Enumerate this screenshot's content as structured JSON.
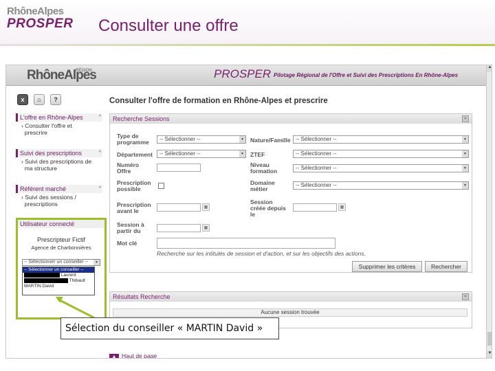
{
  "slide": {
    "logo_top": "RhôneAlpes",
    "logo_main": "PROSPER",
    "title": "Consulter une offre"
  },
  "app": {
    "banner_logo": "RhôneAlpes",
    "banner_logo_sup": "RÉGION",
    "banner_prosper": "PROSPER",
    "banner_subtitle": "Pilotage Régional de l'Offre et Suivi des Prescriptions En Rhône-Alpes",
    "toolbar": {
      "close": "x",
      "home": "⌂",
      "help": "?"
    }
  },
  "sidebar": {
    "sections": [
      {
        "title": "L'offre en Rhône-Alpes",
        "links": [
          "Consulter l'offre et",
          "prescrire"
        ]
      },
      {
        "title": "Suivi des prescriptions",
        "links": [
          "Suivi des prescriptions de",
          "ma structure"
        ]
      },
      {
        "title": "Référent marché",
        "links": [
          "Suivi des sessions /",
          "prescriptions"
        ]
      }
    ],
    "user": {
      "heading": "Utilisateur connecté",
      "name": "Prescripteur Fictif",
      "agency": "Agence de Charbonnières",
      "select_value": "-- Sélectionner un conseiller --",
      "options": [
        {
          "text": "-- Sélectionner un conseiller --",
          "selected": true
        },
        {
          "text": "Laurent",
          "selected": false
        },
        {
          "text": "Thibault",
          "selected": false
        },
        {
          "text": "MARTIN David",
          "selected": false
        }
      ]
    }
  },
  "main": {
    "page_title": "Consulter l'offre de formation en Rhône-Alpes et prescrire",
    "search_panel": {
      "heading": "Recherche Sessions",
      "type_programme": {
        "label_1": "Type de",
        "label_2": "programme",
        "value": "-- Sélectionner --"
      },
      "nature_famille": {
        "label": "Nature/Famille",
        "value": "-- Sélectionner --"
      },
      "departement": {
        "label": "Département",
        "value": "-- Sélectionner --"
      },
      "ztef": {
        "label": "ZTEF",
        "value": "-- Sélectionner --"
      },
      "numero_offre": {
        "label_1": "Numéro",
        "label_2": "Offre"
      },
      "niveau_formation": {
        "label_1": "Niveau",
        "label_2": "formation",
        "value": "-- Sélectionner --"
      },
      "prescription_possible": {
        "label_1": "Prescription",
        "label_2": "possible"
      },
      "domaine_metier": {
        "label_1": "Domaine",
        "label_2": "métier",
        "value": "-- Sélectionner --"
      },
      "prescription_avant": {
        "label_1": "Prescription",
        "label_2": "avant le"
      },
      "session_creee": {
        "label_1": "Session",
        "label_2": "créée depuis",
        "label_3": "le"
      },
      "session_partir": {
        "label_1": "Session à",
        "label_2": "partir du"
      },
      "mot_cle": {
        "label": "Mot clé"
      },
      "hint": "Recherche sur les intitulés de session et d'action, et sur les objectifs des actions.",
      "btn_clear": "Supprimer les critères",
      "btn_search": "Rechercher"
    },
    "results_panel": {
      "heading": "Résultats Recherche",
      "message": "Aucune session trouvée"
    },
    "back_to_top": "Haut de page"
  },
  "callout": {
    "text": "Sélection du conseiller « MARTIN David »"
  },
  "colors": {
    "brand": "#7a1f6e",
    "highlight": "#9bbf2a",
    "selected_option": "#1a2f8a"
  }
}
